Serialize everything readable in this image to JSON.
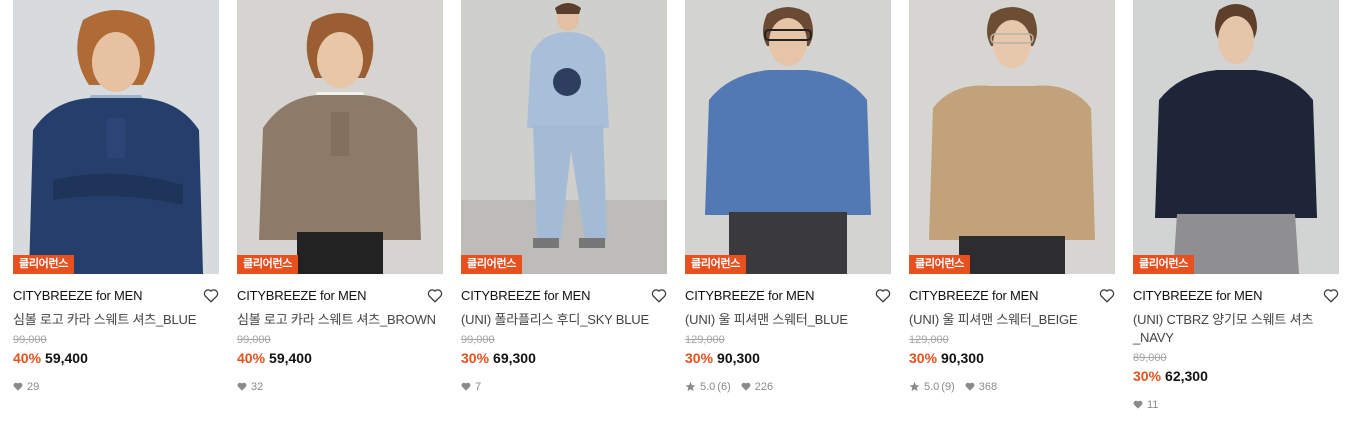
{
  "colors": {
    "accent": "#e8501e",
    "badge_bg": "#e8501e"
  },
  "products": [
    {
      "badge": "클리어런스",
      "brand": "CITYBREEZE for MEN",
      "name": "심볼 로고 카라 스웨트 셔츠_BLUE",
      "original_price": "99,000",
      "discount": "40%",
      "price": "59,400",
      "rating": "",
      "reviews": "",
      "likes": "29",
      "image_desc": "model in navy collared sweatshirt",
      "icons": {
        "wish": "heart-outline-icon",
        "likes": "heart-filled-icon"
      }
    },
    {
      "badge": "클리어런스",
      "brand": "CITYBREEZE for MEN",
      "name": "심볼 로고 카라 스웨트 셔츠_BROWN",
      "original_price": "99,000",
      "discount": "40%",
      "price": "59,400",
      "rating": "",
      "reviews": "",
      "likes": "32",
      "image_desc": "model in brown collared sweatshirt",
      "icons": {
        "wish": "heart-outline-icon",
        "likes": "heart-filled-icon"
      }
    },
    {
      "badge": "클리어런스",
      "brand": "CITYBREEZE for MEN",
      "name": "(UNI) 폴라플리스 후디_SKY BLUE",
      "original_price": "99,000",
      "discount": "30%",
      "price": "69,300",
      "rating": "",
      "reviews": "",
      "likes": "7",
      "image_desc": "model in sky blue fleece hoodie set",
      "icons": {
        "wish": "heart-outline-icon",
        "likes": "heart-filled-icon"
      }
    },
    {
      "badge": "클리어런스",
      "brand": "CITYBREEZE for MEN",
      "name": "(UNI) 울 피셔맨 스웨터_BLUE",
      "original_price": "129,000",
      "discount": "30%",
      "price": "90,300",
      "rating": "5.0",
      "reviews": "(6)",
      "likes": "226",
      "image_desc": "model in blue cable knit sweater",
      "icons": {
        "wish": "heart-outline-icon",
        "likes": "heart-filled-icon",
        "rating": "star-icon"
      }
    },
    {
      "badge": "클리어런스",
      "brand": "CITYBREEZE for MEN",
      "name": "(UNI) 울 피셔맨 스웨터_BEIGE",
      "original_price": "129,000",
      "discount": "30%",
      "price": "90,300",
      "rating": "5.0",
      "reviews": "(9)",
      "likes": "368",
      "image_desc": "model in beige cable knit sweater",
      "icons": {
        "wish": "heart-outline-icon",
        "likes": "heart-filled-icon",
        "rating": "star-icon"
      }
    },
    {
      "badge": "클리어런스",
      "brand": "CITYBREEZE for MEN",
      "name": "(UNI) CTBRZ 양기모 스웨트 셔츠\n_NAVY",
      "original_price": "89,000",
      "discount": "30%",
      "price": "62,300",
      "rating": "",
      "reviews": "",
      "likes": "11",
      "image_desc": "model in navy crewneck sweatshirt",
      "icons": {
        "wish": "heart-outline-icon",
        "likes": "heart-filled-icon"
      }
    }
  ]
}
